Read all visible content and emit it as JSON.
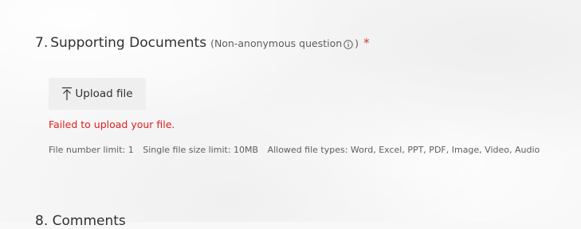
{
  "question": {
    "number": "7.",
    "title": "Supporting Documents",
    "note_prefix": "(Non-anonymous question",
    "note_suffix": ")",
    "required_mark": "*",
    "info_icon": "info-icon"
  },
  "upload": {
    "label": "Upload file",
    "icon": "upload-icon"
  },
  "error_message": "Failed to upload your file.",
  "limits": {
    "file_number": "File number limit: 1",
    "file_size": "Single file size limit: 10MB",
    "file_types": "Allowed file types: Word, Excel, PPT, PDF, Image, Video, Audio"
  },
  "next_question": {
    "number": "8.",
    "title": "Comments"
  },
  "colors": {
    "required": "#d13438",
    "error": "#e02020",
    "button_bg": "#efefef"
  }
}
